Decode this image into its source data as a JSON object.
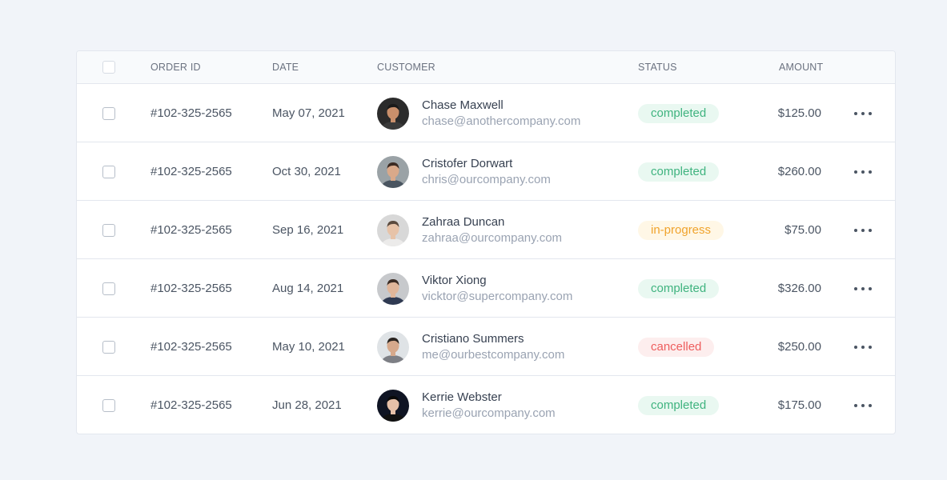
{
  "table": {
    "columns": {
      "order_id": "ORDER ID",
      "date": "DATE",
      "customer": "CUSTOMER",
      "status": "STATUS",
      "amount": "AMOUNT"
    },
    "rows": [
      {
        "order_id": "#102-325-2565",
        "date": "May 07, 2021",
        "customer_name": "Chase Maxwell",
        "customer_email": "chase@anothercompany.com",
        "status": "completed",
        "amount": "$125.00",
        "avatar": "avatar-photo-icon"
      },
      {
        "order_id": "#102-325-2565",
        "date": "Oct 30, 2021",
        "customer_name": "Cristofer Dorwart",
        "customer_email": "chris@ourcompany.com",
        "status": "completed",
        "amount": "$260.00",
        "avatar": "avatar-photo-icon"
      },
      {
        "order_id": "#102-325-2565",
        "date": "Sep 16, 2021",
        "customer_name": "Zahraa Duncan",
        "customer_email": "zahraa@ourcompany.com",
        "status": "in-progress",
        "amount": "$75.00",
        "avatar": "avatar-photo-icon"
      },
      {
        "order_id": "#102-325-2565",
        "date": "Aug 14, 2021",
        "customer_name": "Viktor Xiong",
        "customer_email": "vicktor@supercompany.com",
        "status": "completed",
        "amount": "$326.00",
        "avatar": "avatar-photo-icon"
      },
      {
        "order_id": "#102-325-2565",
        "date": "May 10, 2021",
        "customer_name": "Cristiano Summers",
        "customer_email": "me@ourbestcompany.com",
        "status": "cancelled",
        "amount": "$250.00",
        "avatar": "avatar-photo-icon"
      },
      {
        "order_id": "#102-325-2565",
        "date": "Jun 28, 2021",
        "customer_name": "Kerrie Webster",
        "customer_email": "kerrie@ourcompany.com",
        "status": "completed",
        "amount": "$175.00",
        "avatar": "avatar-photo-icon"
      }
    ]
  },
  "colors": {
    "page_background": "#f1f4f9",
    "completed": "#3fb37f",
    "in_progress": "#f0a32c",
    "cancelled": "#ee5d5d"
  },
  "icons": {
    "row_menu": "more-horizontal-icon",
    "select": "checkbox-icon"
  }
}
